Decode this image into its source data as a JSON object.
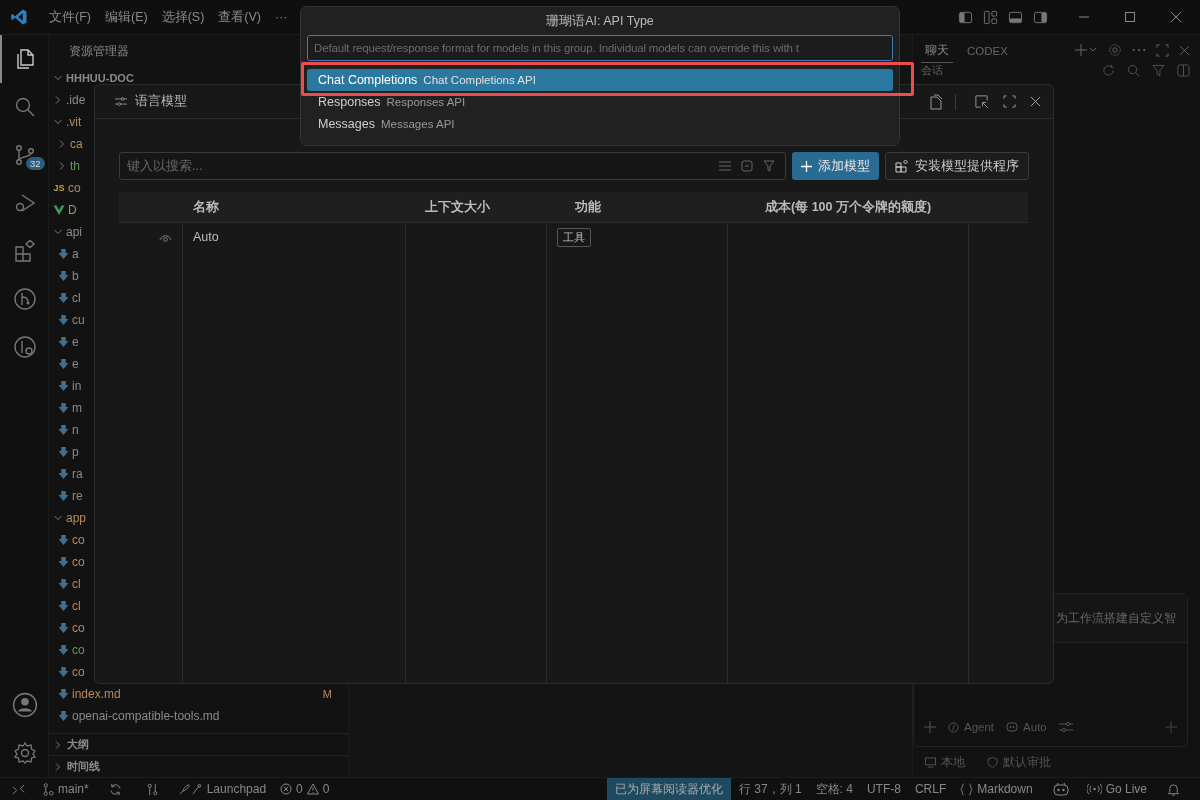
{
  "title_bar": {
    "menus": [
      "文件(F)",
      "编辑(E)",
      "选择(S)",
      "查看(V)",
      "···"
    ]
  },
  "activity_bar": {
    "top": [
      {
        "kind": "files",
        "selected": true
      },
      {
        "kind": "search",
        "selected": false
      },
      {
        "kind": "source-control",
        "selected": false,
        "badge": "32"
      },
      {
        "kind": "run",
        "selected": false
      },
      {
        "kind": "extensions",
        "selected": false
      },
      {
        "kind": "graph",
        "selected": false
      },
      {
        "kind": "graph-search",
        "selected": false
      }
    ],
    "bottom": [
      {
        "kind": "account"
      },
      {
        "kind": "settings"
      }
    ]
  },
  "sidebar": {
    "title": "资源管理器",
    "root": "HHHUU-DOC",
    "tree": [
      {
        "label": ".ide",
        "kind": "folder",
        "expanded": false
      },
      {
        "label": ".vit",
        "kind": "folder",
        "expanded": true,
        "color": "#b88a5a",
        "children": [
          {
            "label": "ca",
            "kind": "folder",
            "expanded": false,
            "color": "#b88a5a"
          },
          {
            "label": "th",
            "kind": "folder",
            "expanded": false,
            "color": "#5f9a5f"
          }
        ]
      },
      {
        "label": "co",
        "kind": "js",
        "icon_label": "JS",
        "color": "#b88a5a"
      },
      {
        "label": "D",
        "kind": "vue",
        "color": "#b88a5a"
      },
      {
        "label": "api",
        "kind": "folder",
        "expanded": true,
        "children": [
          {
            "label": "a",
            "kind": "md"
          },
          {
            "label": "b",
            "kind": "md"
          },
          {
            "label": "cl",
            "kind": "md"
          },
          {
            "label": "cu",
            "kind": "md"
          },
          {
            "label": "e",
            "kind": "md"
          },
          {
            "label": "e",
            "kind": "md"
          },
          {
            "label": "in",
            "kind": "md"
          },
          {
            "label": "m",
            "kind": "md"
          },
          {
            "label": "n",
            "kind": "md"
          },
          {
            "label": "p",
            "kind": "md"
          },
          {
            "label": "ra",
            "kind": "md"
          },
          {
            "label": "re",
            "kind": "md"
          }
        ]
      },
      {
        "label": "app",
        "kind": "folder",
        "expanded": true,
        "color": "#b88a5a",
        "children": [
          {
            "label": "co",
            "kind": "md",
            "color": "#b88a5a"
          },
          {
            "label": "co",
            "kind": "md",
            "color": "#b88a5a"
          },
          {
            "label": "cl",
            "kind": "md",
            "color": "#b88a5a"
          },
          {
            "label": "cl",
            "kind": "md",
            "color": "#b88a5a"
          },
          {
            "label": "co",
            "kind": "md",
            "color": "#b88a5a"
          },
          {
            "label": "co",
            "kind": "md",
            "color": "#5f9a5f"
          },
          {
            "label": "co",
            "kind": "md",
            "color": "#b88a5a"
          },
          {
            "label": "index.md",
            "kind": "md",
            "color": "#b88a5a",
            "badge": "M"
          },
          {
            "label": "openai-compatible-tools.md",
            "kind": "md"
          }
        ]
      }
    ],
    "sections": [
      {
        "label": "大纲",
        "expanded": false
      },
      {
        "label": "时间线",
        "expanded": false
      }
    ]
  },
  "chat": {
    "tabs": [
      {
        "label": "聊天",
        "selected": true
      },
      {
        "label": "CODEX",
        "selected": false
      }
    ],
    "section": "会话",
    "card_text": "为工作流搭建自定义智",
    "mode": "Agent",
    "model": "Auto",
    "footer": [
      {
        "kind": "local",
        "label": "本地"
      },
      {
        "kind": "approval",
        "label": "默认审批"
      }
    ]
  },
  "dialog": {
    "title": "语言模型",
    "search_placeholder": "键入以搜索...",
    "buttons": [
      {
        "kind": "primary",
        "label": "添加模型"
      },
      {
        "kind": "secondary",
        "label": "安装模型提供程序"
      }
    ],
    "columns": [
      "名称",
      "上下文大小",
      "功能",
      "成本(每 100 万个令牌的额度)"
    ],
    "rows": [
      {
        "visible": true,
        "name": "Auto",
        "capabilities": [
          "工具"
        ]
      }
    ]
  },
  "quick_pick": {
    "title": "珊瑚语AI: API Type",
    "placeholder": "Default request/response format for models in this group. Individual models can override this with t",
    "items": [
      {
        "label": "Chat Completions",
        "description": "Chat Completions API",
        "selected": true
      },
      {
        "label": "Responses",
        "description": "Responses API",
        "selected": false
      },
      {
        "label": "Messages",
        "description": "Messages API",
        "selected": false
      }
    ]
  },
  "status_bar": {
    "left": [
      {
        "kind": "remote"
      },
      {
        "kind": "branch",
        "text": "main*"
      },
      {
        "kind": "sync"
      },
      {
        "kind": "graph"
      },
      {
        "kind": "launchpad",
        "text": "Launchpad"
      },
      {
        "kind": "problems",
        "errors": "0",
        "warnings": "0"
      }
    ],
    "right": [
      {
        "kind": "text",
        "text": "已为屏幕阅读器优化",
        "highlighted": true
      },
      {
        "kind": "text",
        "text": "行 37，列 1",
        "highlighted": false
      },
      {
        "kind": "text",
        "text": "空格: 4",
        "highlighted": false
      },
      {
        "kind": "text",
        "text": "UTF-8",
        "highlighted": false
      },
      {
        "kind": "text",
        "text": "CRLF",
        "highlighted": false
      },
      {
        "kind": "language",
        "text": "Markdown",
        "highlighted": false
      },
      {
        "kind": "copilot"
      },
      {
        "kind": "golive",
        "text": "Go Live",
        "highlighted": false
      },
      {
        "kind": "bell"
      }
    ]
  }
}
